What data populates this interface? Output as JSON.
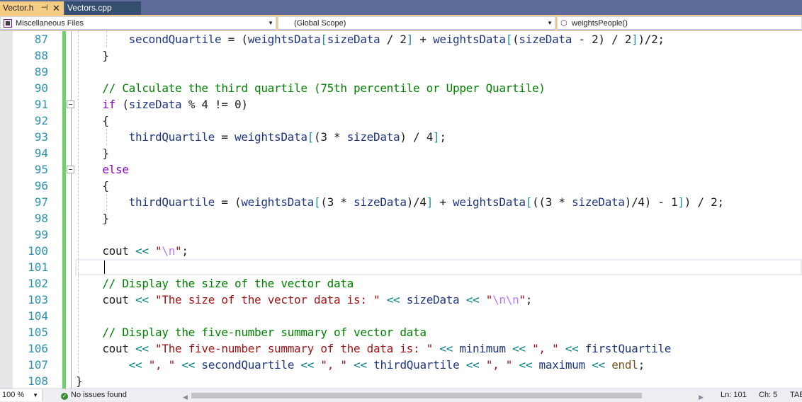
{
  "tabs": [
    {
      "label": "Vector.h",
      "active": true,
      "pin_icon": "pin-icon",
      "close_icon": "close-icon"
    },
    {
      "label": "Vectors.cpp",
      "active": false
    }
  ],
  "navbar": {
    "project": "Miscellaneous Files",
    "scope": "(Global Scope)",
    "member": "weightsPeople()",
    "project_icon": "project-icon",
    "member_icon": "method-icon"
  },
  "editor": {
    "lines": [
      {
        "n": "87",
        "tokens": [
          [
            "sp",
            "        "
          ],
          [
            "id",
            "secondQuartile"
          ],
          [
            "t",
            " = ("
          ],
          [
            "id",
            "weightsData"
          ],
          [
            "br",
            "["
          ],
          [
            "id",
            "sizeData"
          ],
          [
            "t",
            " / 2"
          ],
          [
            "br",
            "]"
          ],
          [
            "t",
            " + "
          ],
          [
            "id",
            "weightsData"
          ],
          [
            "br",
            "["
          ],
          [
            "t",
            "("
          ],
          [
            "id",
            "sizeData"
          ],
          [
            "t",
            " - 2) / 2"
          ],
          [
            "br",
            "]"
          ],
          [
            "t",
            ")/2;"
          ]
        ]
      },
      {
        "n": "88",
        "tokens": [
          [
            "sp",
            "    "
          ],
          [
            "t",
            "}"
          ]
        ]
      },
      {
        "n": "89",
        "tokens": []
      },
      {
        "n": "90",
        "tokens": [
          [
            "sp",
            "    "
          ],
          [
            "cm",
            "// Calculate the third quartile (75th percentile or Upper Quartile)"
          ]
        ]
      },
      {
        "n": "91",
        "tokens": [
          [
            "sp",
            "    "
          ],
          [
            "kw",
            "if"
          ],
          [
            "t",
            " ("
          ],
          [
            "id",
            "sizeData"
          ],
          [
            "t",
            " % 4 != 0)"
          ]
        ]
      },
      {
        "n": "92",
        "tokens": [
          [
            "sp",
            "    "
          ],
          [
            "t",
            "{"
          ]
        ]
      },
      {
        "n": "93",
        "tokens": [
          [
            "sp",
            "        "
          ],
          [
            "id",
            "thirdQuartile"
          ],
          [
            "t",
            " = "
          ],
          [
            "id",
            "weightsData"
          ],
          [
            "br",
            "["
          ],
          [
            "t",
            "(3 * "
          ],
          [
            "id",
            "sizeData"
          ],
          [
            "t",
            ") / 4"
          ],
          [
            "br",
            "]"
          ],
          [
            "t",
            ";"
          ]
        ]
      },
      {
        "n": "94",
        "tokens": [
          [
            "sp",
            "    "
          ],
          [
            "t",
            "}"
          ]
        ]
      },
      {
        "n": "95",
        "tokens": [
          [
            "sp",
            "    "
          ],
          [
            "kw",
            "else"
          ]
        ]
      },
      {
        "n": "96",
        "tokens": [
          [
            "sp",
            "    "
          ],
          [
            "t",
            "{"
          ]
        ]
      },
      {
        "n": "97",
        "tokens": [
          [
            "sp",
            "        "
          ],
          [
            "id",
            "thirdQuartile"
          ],
          [
            "t",
            " = ("
          ],
          [
            "id",
            "weightsData"
          ],
          [
            "br",
            "["
          ],
          [
            "t",
            "(3 * "
          ],
          [
            "id",
            "sizeData"
          ],
          [
            "t",
            ")/4"
          ],
          [
            "br",
            "]"
          ],
          [
            "t",
            " + "
          ],
          [
            "id",
            "weightsData"
          ],
          [
            "br",
            "["
          ],
          [
            "t",
            "((3 * "
          ],
          [
            "id",
            "sizeData"
          ],
          [
            "t",
            ")/4) - 1"
          ],
          [
            "br",
            "]"
          ],
          [
            "t",
            ") / 2;"
          ]
        ]
      },
      {
        "n": "98",
        "tokens": [
          [
            "sp",
            "    "
          ],
          [
            "t",
            "}"
          ]
        ]
      },
      {
        "n": "99",
        "tokens": []
      },
      {
        "n": "100",
        "tokens": [
          [
            "sp",
            "    "
          ],
          [
            "t",
            "cout "
          ],
          [
            "op",
            "<<"
          ],
          [
            "t",
            " "
          ],
          [
            "st",
            "\""
          ],
          [
            "esc",
            "\\n"
          ],
          [
            "st",
            "\""
          ],
          [
            "t",
            ";"
          ]
        ]
      },
      {
        "n": "101",
        "tokens": []
      },
      {
        "n": "102",
        "tokens": [
          [
            "sp",
            "    "
          ],
          [
            "cm",
            "// Display the size of the vector data"
          ]
        ]
      },
      {
        "n": "103",
        "tokens": [
          [
            "sp",
            "    "
          ],
          [
            "t",
            "cout "
          ],
          [
            "op",
            "<<"
          ],
          [
            "t",
            " "
          ],
          [
            "st",
            "\"The size of the vector data is: \""
          ],
          [
            "t",
            " "
          ],
          [
            "op",
            "<<"
          ],
          [
            "t",
            " "
          ],
          [
            "id",
            "sizeData"
          ],
          [
            "t",
            " "
          ],
          [
            "op",
            "<<"
          ],
          [
            "t",
            " "
          ],
          [
            "st",
            "\""
          ],
          [
            "esc",
            "\\n\\n"
          ],
          [
            "st",
            "\""
          ],
          [
            "t",
            ";"
          ]
        ]
      },
      {
        "n": "104",
        "tokens": []
      },
      {
        "n": "105",
        "tokens": [
          [
            "sp",
            "    "
          ],
          [
            "cm",
            "// Display the five-number summary of vector data"
          ]
        ]
      },
      {
        "n": "106",
        "tokens": [
          [
            "sp",
            "    "
          ],
          [
            "t",
            "cout "
          ],
          [
            "op",
            "<<"
          ],
          [
            "t",
            " "
          ],
          [
            "st",
            "\"The five-number summary of the data is: \""
          ],
          [
            "t",
            " "
          ],
          [
            "op",
            "<<"
          ],
          [
            "t",
            " "
          ],
          [
            "id",
            "minimum"
          ],
          [
            "t",
            " "
          ],
          [
            "op",
            "<<"
          ],
          [
            "t",
            " "
          ],
          [
            "st",
            "\", \""
          ],
          [
            "t",
            " "
          ],
          [
            "op",
            "<<"
          ],
          [
            "t",
            " "
          ],
          [
            "id",
            "firstQuartile"
          ]
        ]
      },
      {
        "n": "107",
        "tokens": [
          [
            "sp",
            "        "
          ],
          [
            "op",
            "<<"
          ],
          [
            "t",
            " "
          ],
          [
            "st",
            "\", \""
          ],
          [
            "t",
            " "
          ],
          [
            "op",
            "<<"
          ],
          [
            "t",
            " "
          ],
          [
            "id",
            "secondQuartile"
          ],
          [
            "t",
            " "
          ],
          [
            "op",
            "<<"
          ],
          [
            "t",
            " "
          ],
          [
            "st",
            "\", \""
          ],
          [
            "t",
            " "
          ],
          [
            "op",
            "<<"
          ],
          [
            "t",
            " "
          ],
          [
            "id",
            "thirdQuartile"
          ],
          [
            "t",
            " "
          ],
          [
            "op",
            "<<"
          ],
          [
            "t",
            " "
          ],
          [
            "st",
            "\", \""
          ],
          [
            "t",
            " "
          ],
          [
            "op",
            "<<"
          ],
          [
            "t",
            " "
          ],
          [
            "id",
            "maximum"
          ],
          [
            "t",
            " "
          ],
          [
            "op",
            "<<"
          ],
          [
            "t",
            " "
          ],
          [
            "fn",
            "endl"
          ],
          [
            "t",
            ";"
          ]
        ]
      },
      {
        "n": "108",
        "tokens": [
          [
            "t",
            "}"
          ]
        ]
      }
    ],
    "fold_lines": [
      "91",
      "95"
    ],
    "current_line": "101"
  },
  "statusbar": {
    "zoom": "100 %",
    "issues": "No issues found",
    "ln": "Ln: 101",
    "ch": "Ch: 5",
    "mode": "TABS"
  }
}
